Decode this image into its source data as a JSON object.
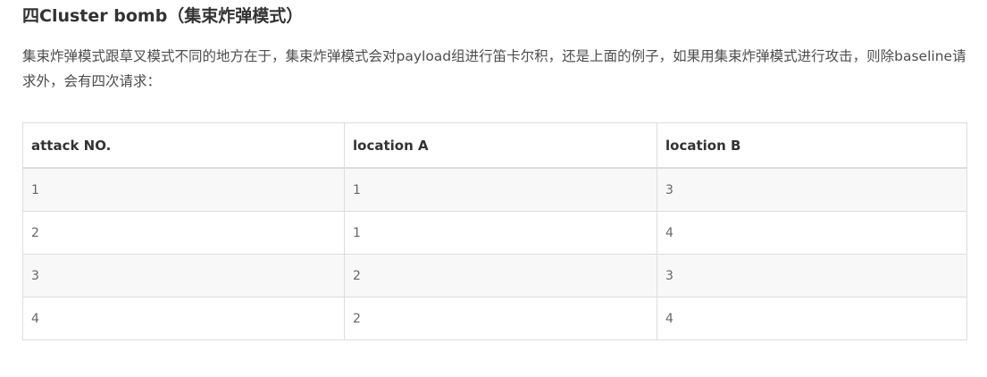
{
  "heading": "四Cluster bomb（集束炸弹模式）",
  "paragraph": "集束炸弹模式跟草叉模式不同的地方在于，集束炸弹模式会对payload组进行笛卡尔积，还是上面的例子，如果用集束炸弹模式进行攻击，则除baseline请求外，会有四次请求：",
  "table": {
    "headers": [
      "attack NO.",
      "location A",
      "location B"
    ],
    "rows": [
      [
        "1",
        "1",
        "3"
      ],
      [
        "2",
        "1",
        "4"
      ],
      [
        "3",
        "2",
        "3"
      ],
      [
        "4",
        "2",
        "4"
      ]
    ]
  }
}
